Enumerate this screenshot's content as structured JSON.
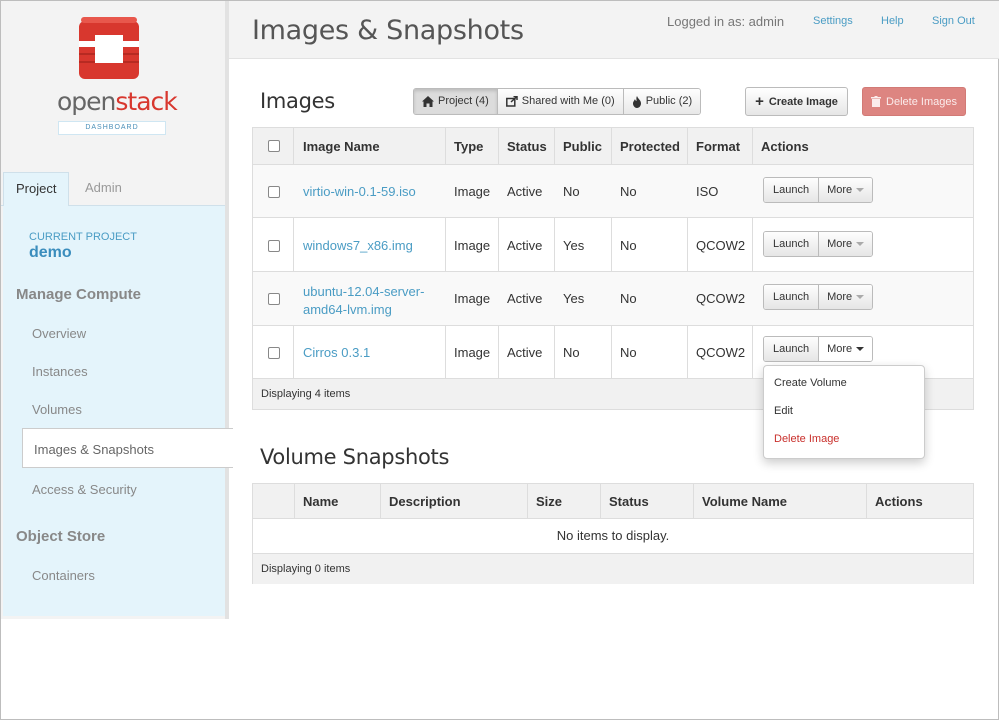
{
  "brand": {
    "word_left": "open",
    "word_right": "stack",
    "badge": "DASHBOARD"
  },
  "sidebar": {
    "tabs": [
      {
        "label": "Project",
        "active": true
      },
      {
        "label": "Admin",
        "active": false
      }
    ],
    "current_project_label": "CURRENT PROJECT",
    "current_project": "demo",
    "sections": [
      {
        "title": "Manage Compute",
        "items": [
          "Overview",
          "Instances",
          "Volumes",
          "Images & Snapshots",
          "Access & Security"
        ]
      },
      {
        "title": "Object Store",
        "items": [
          "Containers"
        ]
      }
    ],
    "active_item": "Images & Snapshots"
  },
  "header": {
    "title": "Images & Snapshots",
    "user_info": "Logged in as: admin",
    "links": [
      "Settings",
      "Help",
      "Sign Out"
    ]
  },
  "images": {
    "title": "Images",
    "filters": [
      {
        "label": "Project (4)",
        "icon": "home-icon",
        "active": true
      },
      {
        "label": "Shared with Me (0)",
        "icon": "share-icon",
        "active": false
      },
      {
        "label": "Public (2)",
        "icon": "fire-icon",
        "active": false
      }
    ],
    "create_label": "Create Image",
    "delete_label": "Delete Images",
    "columns": [
      "Image Name",
      "Type",
      "Status",
      "Public",
      "Protected",
      "Format",
      "Actions"
    ],
    "rows": [
      {
        "name": "virtio-win-0.1-59.iso",
        "name2": "",
        "type": "Image",
        "status": "Active",
        "public": "No",
        "protected": "No",
        "format": "ISO"
      },
      {
        "name": "windows7_x86.img",
        "name2": "",
        "type": "Image",
        "status": "Active",
        "public": "Yes",
        "protected": "No",
        "format": "QCOW2"
      },
      {
        "name": "ubuntu-12.04-server-",
        "name2": "amd64-lvm.img",
        "type": "Image",
        "status": "Active",
        "public": "Yes",
        "protected": "No",
        "format": "QCOW2"
      },
      {
        "name": "Cirros 0.3.1",
        "name2": "",
        "type": "Image",
        "status": "Active",
        "public": "No",
        "protected": "No",
        "format": "QCOW2"
      }
    ],
    "launch_label": "Launch",
    "more_label": "More",
    "footer": "Displaying 4 items",
    "dropdown": [
      "Create Volume",
      "Edit",
      "Delete Image"
    ]
  },
  "snapshots": {
    "title": "Volume Snapshots",
    "columns": [
      "Name",
      "Description",
      "Size",
      "Status",
      "Volume Name",
      "Actions"
    ],
    "empty": "No items to display.",
    "footer": "Displaying 0 items"
  },
  "colors": {
    "accent": "#4a9cc4",
    "danger_button": "#dd8581",
    "sidebar_panel": "#e4f4fb",
    "logo_red": "#d8372e"
  }
}
